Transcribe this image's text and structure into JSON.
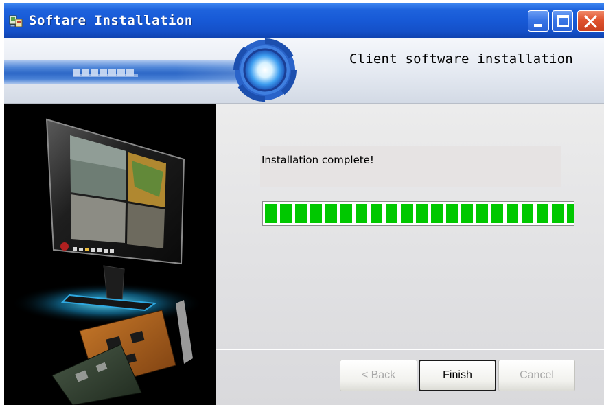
{
  "window": {
    "title": "Softare Installation",
    "controls": [
      "minimize-icon",
      "maximize-icon",
      "close-icon"
    ]
  },
  "header": {
    "title": "Client software installation"
  },
  "content": {
    "status_text": "Installation complete!",
    "progress": {
      "value_percent": 100,
      "segments": 21,
      "color": "#00c800"
    }
  },
  "buttons": {
    "back": "< Back",
    "finish": "Finish",
    "cancel": "Cancel"
  },
  "colors": {
    "titlebar": "#1759d6",
    "progress": "#00c800",
    "close_button": "#e0532e"
  }
}
